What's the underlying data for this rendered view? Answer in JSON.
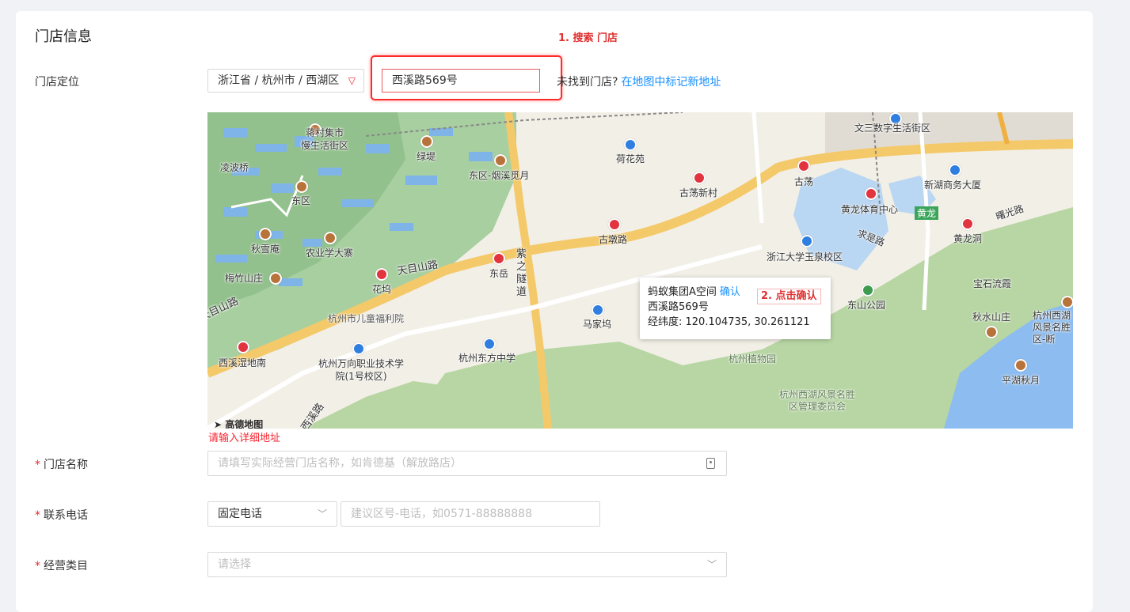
{
  "section": {
    "title": "门店信息"
  },
  "annotations": {
    "step1": "1. 搜索 门店",
    "step2": "2. 点击确认"
  },
  "location": {
    "label": "门店定位",
    "region": "浙江省 / 杭州市 / 西湖区",
    "search_value": "西溪路569号",
    "not_found_text": "未找到门店?",
    "mark_new_link": "在地图中标记新地址"
  },
  "map": {
    "logo": "高德地图",
    "pois": [
      {
        "name": "蒋村集市",
        "type": "brown"
      },
      {
        "name": "慢生活街区",
        "type": "text"
      },
      {
        "name": "绿堤",
        "type": "brown"
      },
      {
        "name": "凌波桥",
        "type": "text"
      },
      {
        "name": "东区",
        "type": "brown"
      },
      {
        "name": "东区-烟溪觅月",
        "type": "brown"
      },
      {
        "name": "荷花苑",
        "type": "blue"
      },
      {
        "name": "古荡新村",
        "type": "red"
      },
      {
        "name": "古荡",
        "type": "red"
      },
      {
        "name": "文三数字生活街区",
        "type": "blue"
      },
      {
        "name": "新湖商务大厦",
        "type": "blue"
      },
      {
        "name": "黄龙体育中心",
        "type": "red"
      },
      {
        "name": "黄龙",
        "type": "text"
      },
      {
        "name": "黄龙洞",
        "type": "red"
      },
      {
        "name": "曙光路",
        "type": "text"
      },
      {
        "name": "秋雪庵",
        "type": "brown"
      },
      {
        "name": "农业学大寨",
        "type": "brown"
      },
      {
        "name": "古墩路",
        "type": "red"
      },
      {
        "name": "浙江大学玉泉校区",
        "type": "blue"
      },
      {
        "name": "求是路",
        "type": "text"
      },
      {
        "name": "宝石流霞",
        "type": "text"
      },
      {
        "name": "梅竹山庄",
        "type": "brown"
      },
      {
        "name": "天目山路",
        "type": "text"
      },
      {
        "name": "东岳",
        "type": "red"
      },
      {
        "name": "紫之隧道",
        "type": "text"
      },
      {
        "name": "花坞",
        "type": "red"
      },
      {
        "name": "东山公园",
        "type": "green"
      },
      {
        "name": "秋水山庄",
        "type": "brown"
      },
      {
        "name": "杭州西湖风景名胜区-断",
        "type": "brown"
      },
      {
        "name": "天目山路",
        "type": "text"
      },
      {
        "name": "杭州市儿童福利院",
        "type": "text"
      },
      {
        "name": "马家坞",
        "type": "blue"
      },
      {
        "name": "西溪湿地南",
        "type": "red"
      },
      {
        "name": "杭州万向职业技术学院(1号校区)",
        "type": "blue"
      },
      {
        "name": "杭州东方中学",
        "type": "blue"
      },
      {
        "name": "杭州植物园",
        "type": "text"
      },
      {
        "name": "平湖秋月",
        "type": "brown"
      },
      {
        "name": "杭州西湖风景名胜区管理委员会",
        "type": "text"
      },
      {
        "name": "西溪路",
        "type": "text"
      },
      {
        "name": "古荡",
        "type": "text"
      }
    ]
  },
  "popup": {
    "name": "蚂蚁集团A空间",
    "confirm": "确认",
    "address": "西溪路569号",
    "coords": "经纬度: 120.104735, 30.261121"
  },
  "error_message": "请输入详细地址",
  "store_name": {
    "label": "门店名称",
    "placeholder": "请填写实际经营门店名称，如肯德基（解放路店）"
  },
  "phone": {
    "label": "联系电话",
    "type_value": "固定电话",
    "placeholder": "建议区号-电话，如0571-88888888"
  },
  "category": {
    "label": "经营类目",
    "placeholder": "请选择"
  },
  "required_mark": "*"
}
